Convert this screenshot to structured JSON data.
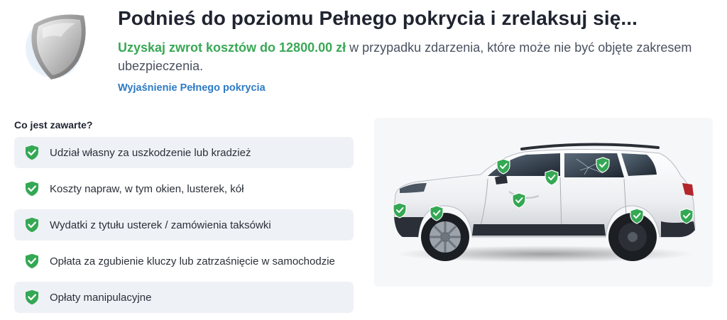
{
  "header": {
    "title": "Podnieś do poziomu Pełnego pokrycia i zrelaksuj się...",
    "subtitle_highlight": "Uzyskaj zwrot kosztów do 12800.00 zł",
    "subtitle_rest": " w przypadku zdarzenia, które może nie być objęte zakresem ubezpieczenia.",
    "link": "Wyjaśnienie Pełnego pokrycia"
  },
  "coverage": {
    "title": "Co jest zawarte?",
    "items": [
      "Udział własny za uszkodzenie lub kradzież",
      "Koszty napraw, w tym okien, lusterek, kół",
      "Wydatki z tytułu usterek / zamówienia taksówki",
      "Opłata za zgubienie kluczy lub zatrzaśnięcie w samochodzie",
      "Opłaty manipulacyjne"
    ]
  },
  "colors": {
    "accent_green": "#3aa856",
    "link_blue": "#2e7bc4",
    "check_green": "#34a853"
  },
  "icons": {
    "header": "shield-icon",
    "list": "check-shield-icon",
    "car": "car-image"
  }
}
